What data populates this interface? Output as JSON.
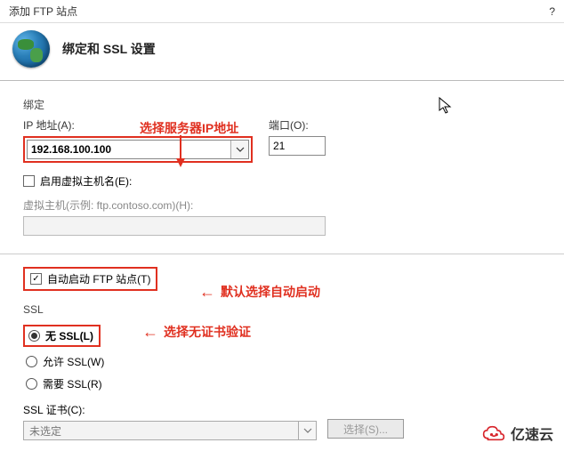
{
  "titlebar": {
    "title": "添加 FTP 站点",
    "help": "?"
  },
  "header": {
    "title": "绑定和 SSL 设置"
  },
  "annotations": {
    "ip_hint": "选择服务器IP地址",
    "autostart_hint": "默认选择自动启动",
    "nossl_hint": "选择无证书验证"
  },
  "binding_section": {
    "group_label": "绑定",
    "ip_label": "IP 地址(A):",
    "ip_value": "192.168.100.100",
    "port_label": "端口(O):",
    "port_value": "21",
    "vhost_checkbox_label": "启用虚拟主机名(E):",
    "vhost_example_label": "虚拟主机(示例: ftp.contoso.com)(H):"
  },
  "autostart": {
    "label": "自动启动 FTP 站点(T)"
  },
  "ssl_section": {
    "group_label": "SSL",
    "no_ssl": "无 SSL(L)",
    "allow_ssl": "允许 SSL(W)",
    "require_ssl": "需要 SSL(R)",
    "cert_label": "SSL 证书(C):",
    "cert_placeholder": "未选定",
    "select_button": "选择(S)..."
  },
  "watermark": {
    "text": "亿速云"
  }
}
